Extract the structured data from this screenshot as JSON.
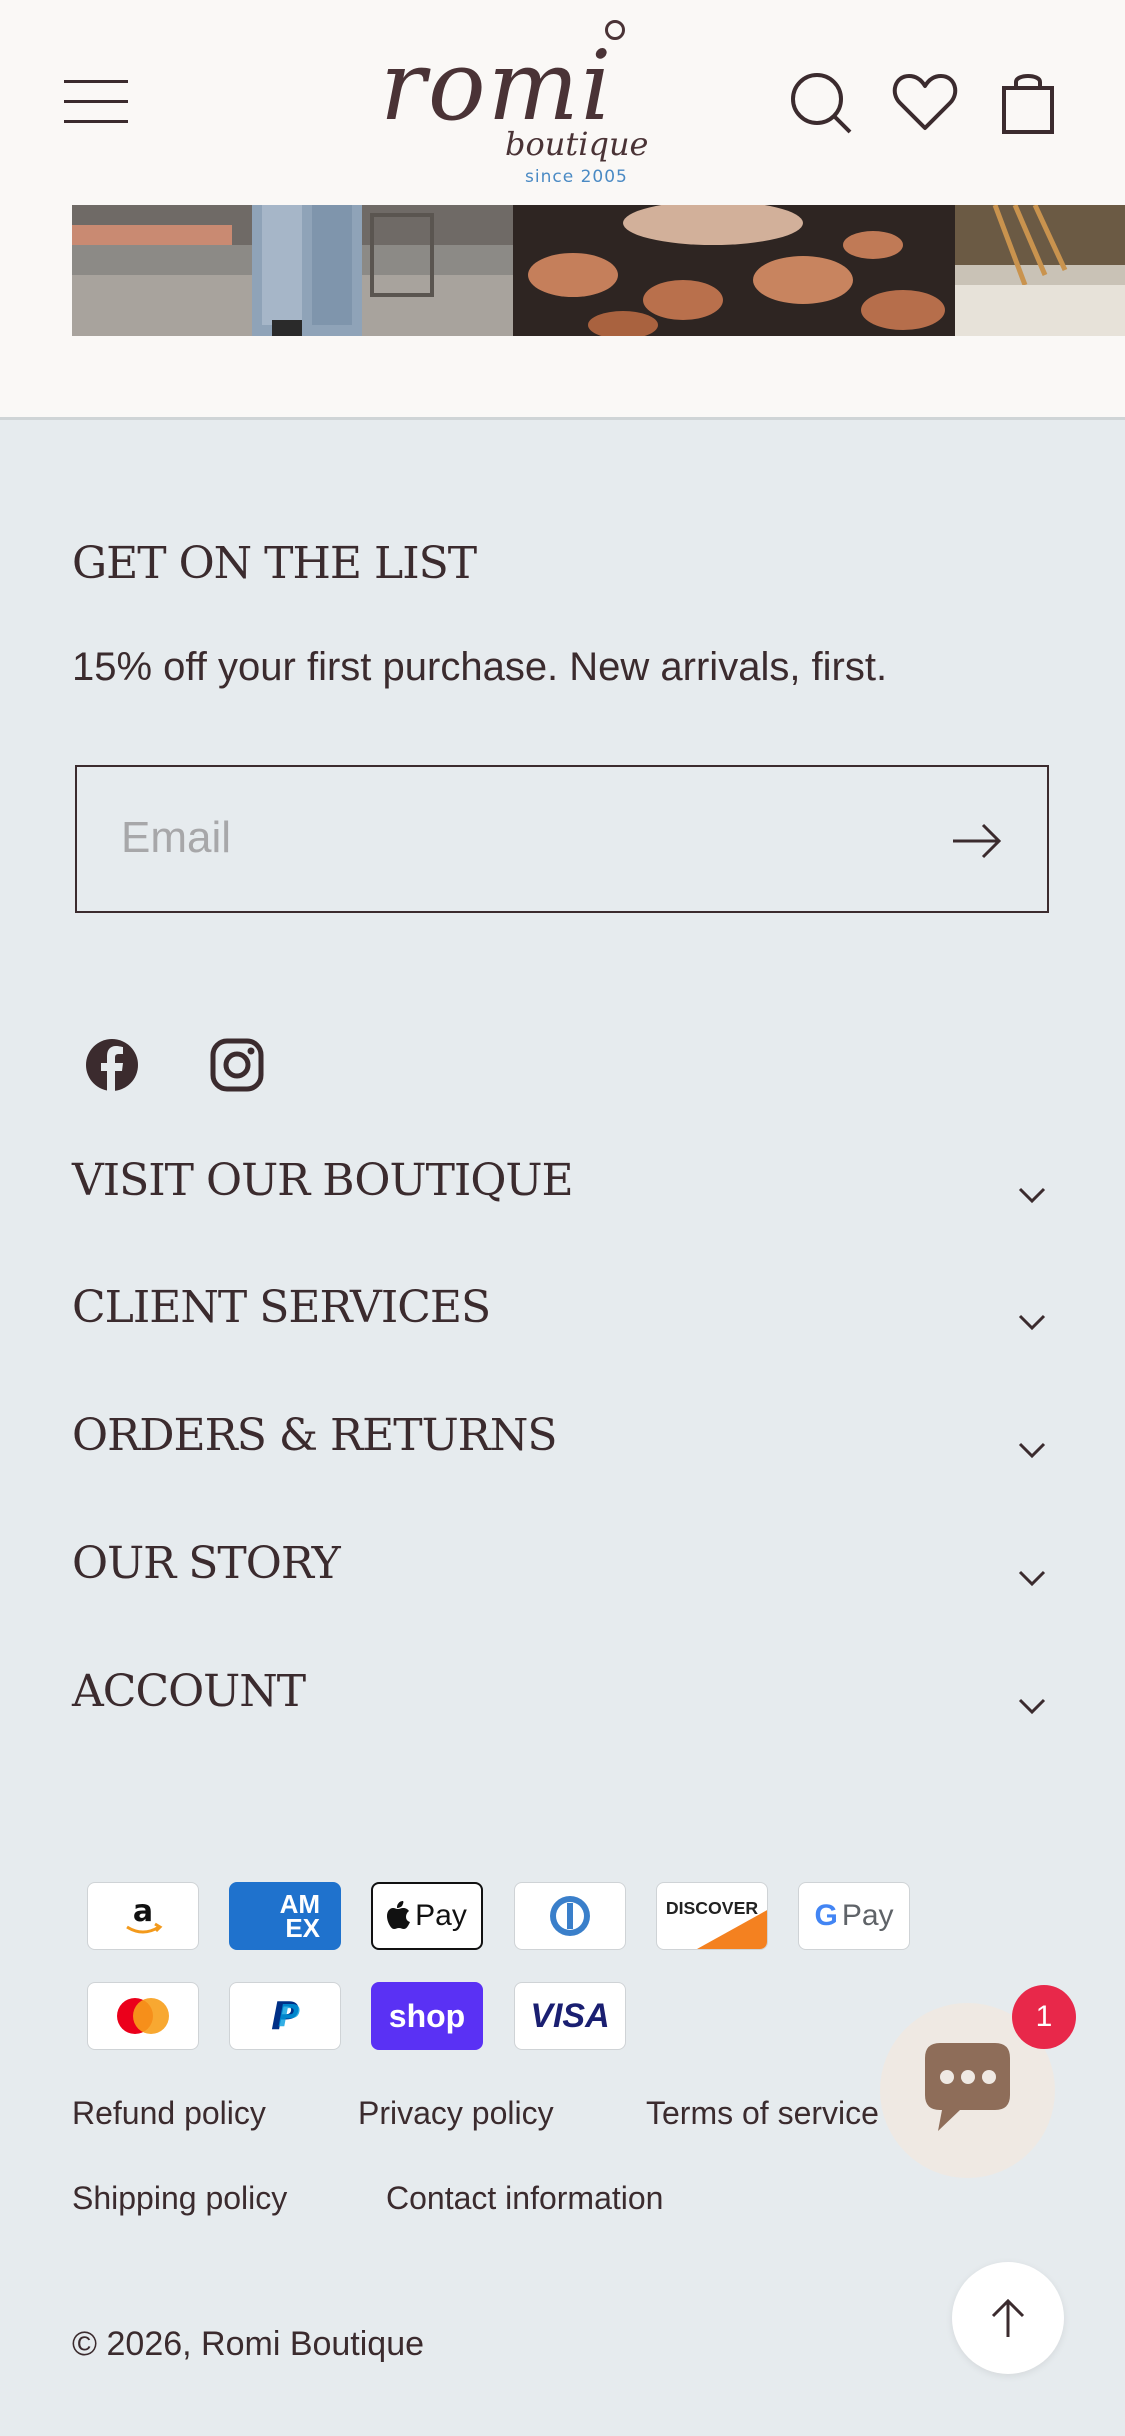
{
  "header": {
    "logo_main": "romi",
    "logo_sub": "boutique",
    "logo_since": "since 2005",
    "icons": [
      "menu-icon",
      "search-icon",
      "heart-icon",
      "bag-icon"
    ]
  },
  "newsletter": {
    "heading": "GET ON THE LIST",
    "text": "15% off your first purchase. New arrivals, first.",
    "email_placeholder": "Email"
  },
  "social": [
    "facebook-icon",
    "instagram-icon"
  ],
  "footer_sections": [
    {
      "label": "VISIT OUR BOUTIQUE"
    },
    {
      "label": "CLIENT SERVICES"
    },
    {
      "label": "ORDERS & RETURNS"
    },
    {
      "label": "OUR STORY"
    },
    {
      "label": "ACCOUNT"
    }
  ],
  "payments": {
    "amex": "AM EX",
    "applepay": "Pay",
    "discover": "DISCOVER",
    "gpay": "Pay",
    "shop": "shop",
    "visa": "VISA"
  },
  "policies": {
    "refund": "Refund policy",
    "privacy": "Privacy policy",
    "terms": "Terms of service",
    "shipping": "Shipping policy",
    "contact": "Contact information"
  },
  "copyright": "© 2026, Romi Boutique",
  "chat_badge": "1",
  "colors": {
    "background": "#e6ebee",
    "text": "#3b2b2e",
    "badge": "#e8284a",
    "header_bg": "#faf8f6"
  }
}
